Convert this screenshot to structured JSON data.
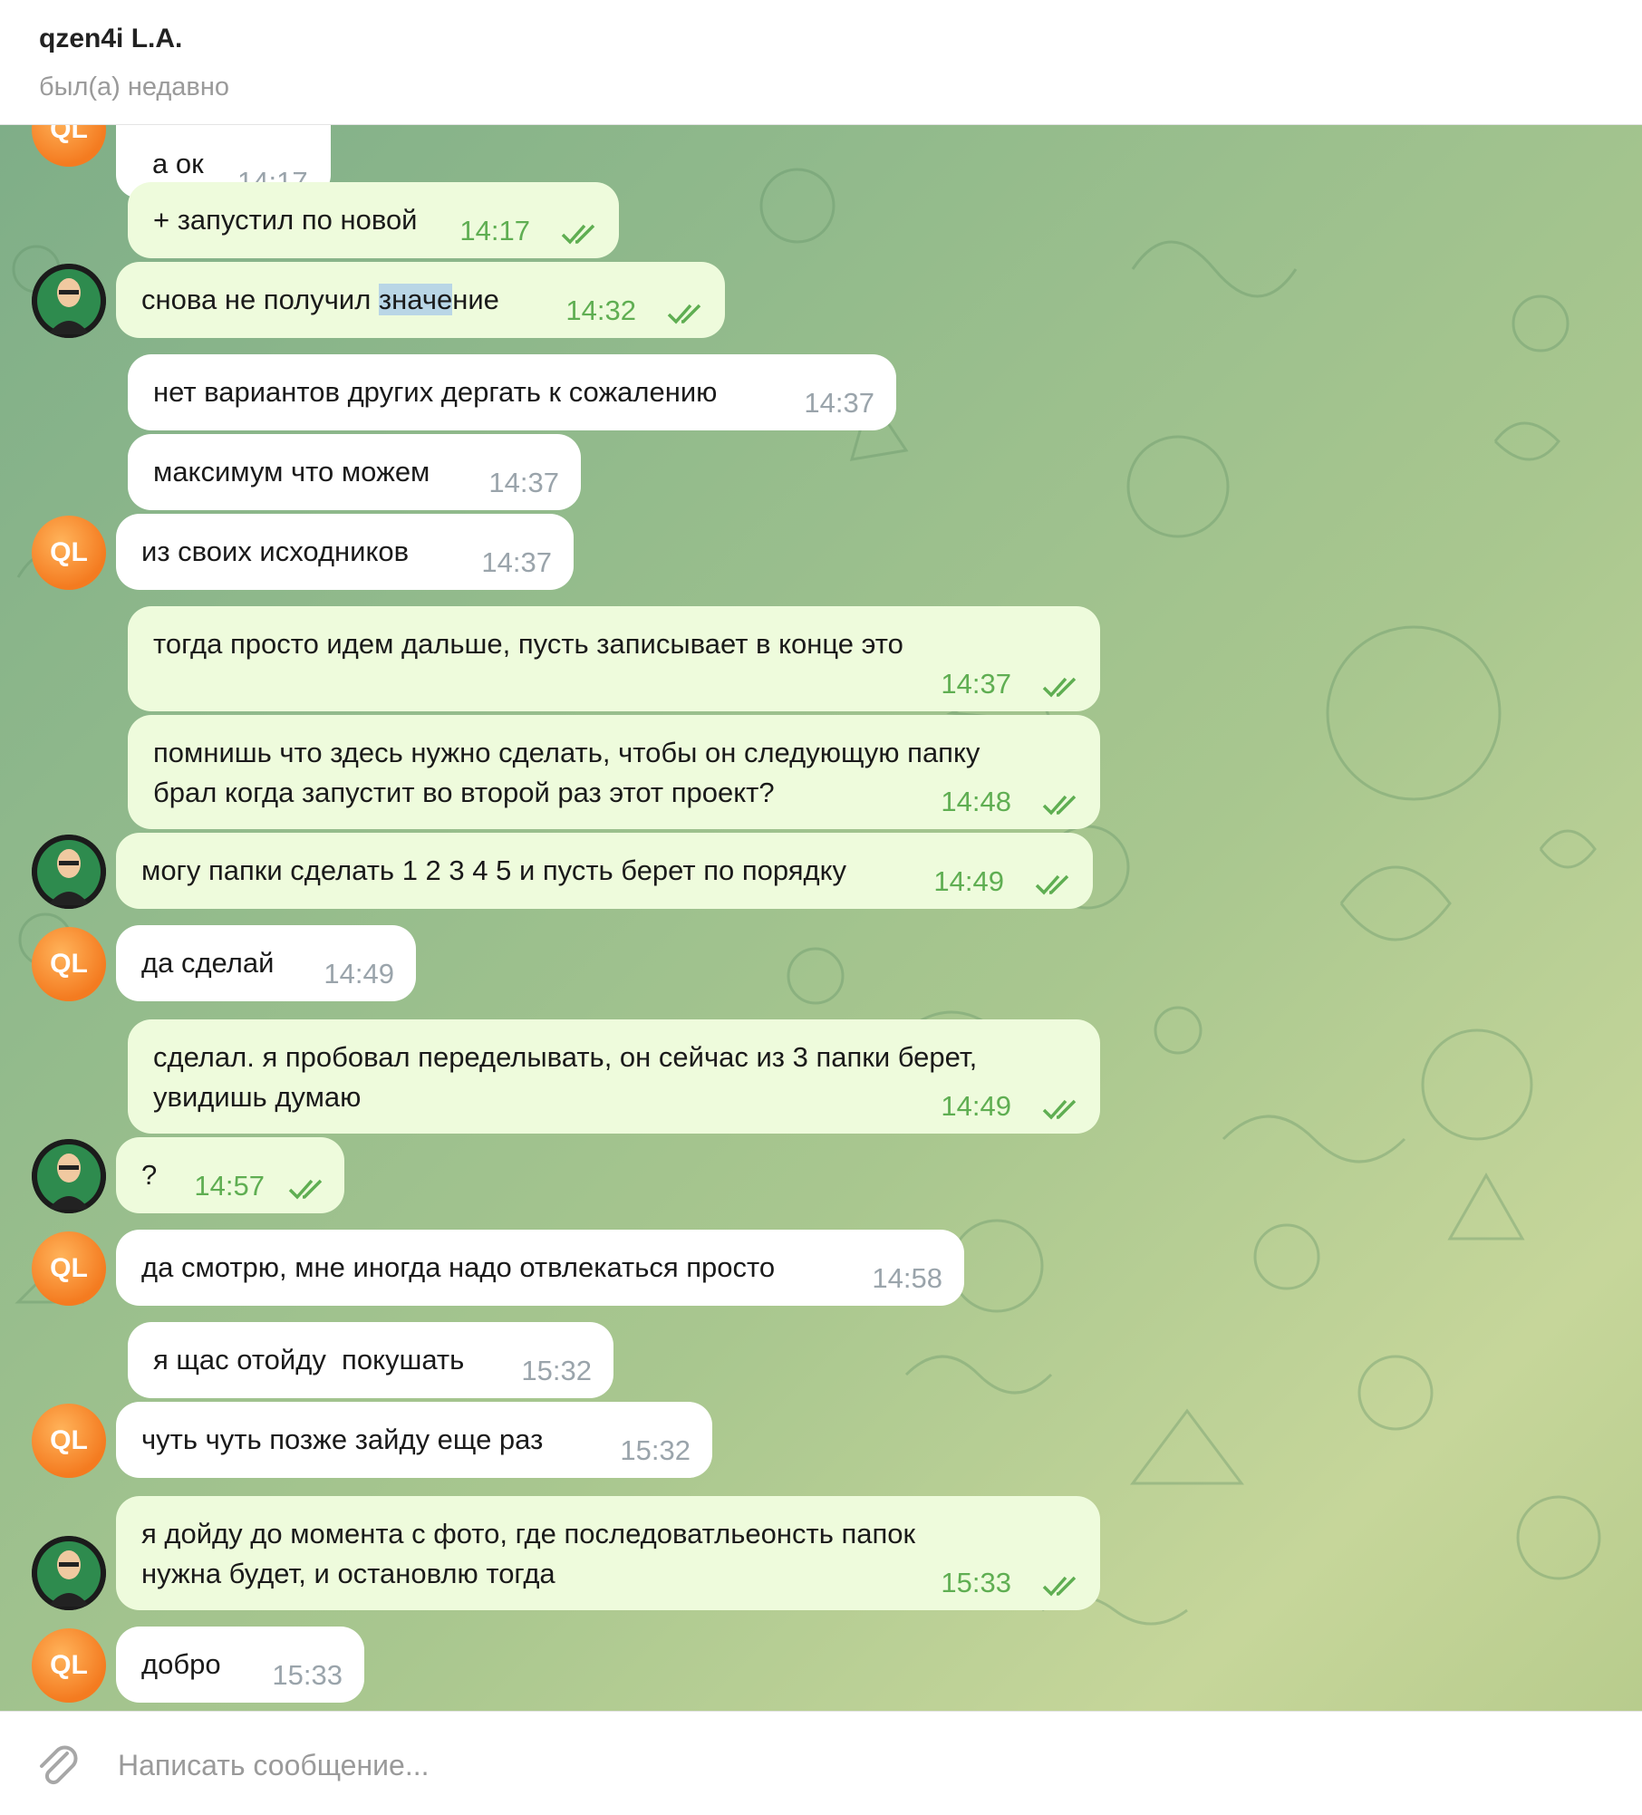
{
  "header": {
    "title": "qzen4i L.A.",
    "status": "был(а) недавно"
  },
  "avatars": {
    "ql_initials": "QL"
  },
  "messages": [
    {
      "dir": "in",
      "text": "а ок",
      "time": "14:17"
    },
    {
      "dir": "out",
      "text": "+ запустил по новой",
      "time": "14:17",
      "read": true
    },
    {
      "dir": "out",
      "text_before": "снова не получил ",
      "text_selected": "значе",
      "text_after": "ние",
      "time": "14:32",
      "read": true
    },
    {
      "dir": "in",
      "text": "нет вариантов других дергать к сожалению",
      "time": "14:37"
    },
    {
      "dir": "in",
      "text": "максимум что можем",
      "time": "14:37"
    },
    {
      "dir": "in",
      "text": "из своих исходников",
      "time": "14:37"
    },
    {
      "dir": "out",
      "text": "тогда просто идем дальше, пусть записывает в конце это",
      "time": "14:37",
      "read": true
    },
    {
      "dir": "out",
      "text": "помнишь что здесь нужно сделать, чтобы он следующую папку\nбрал когда запустит во второй раз этот проект?",
      "time": "14:48",
      "read": true
    },
    {
      "dir": "out",
      "text": "могу папки сделать 1 2 3 4 5 и пусть берет по порядку",
      "time": "14:49",
      "read": true
    },
    {
      "dir": "in",
      "text": "да сделай",
      "time": "14:49"
    },
    {
      "dir": "out",
      "text": "сделал. я пробовал переделывать, он сейчас из 3 папки берет,\nувидишь думаю",
      "time": "14:49",
      "read": true
    },
    {
      "dir": "out",
      "text": "?",
      "time": "14:57",
      "read": true
    },
    {
      "dir": "in",
      "text": "да смотрю, мне иногда надо отвлекаться просто",
      "time": "14:58"
    },
    {
      "dir": "in",
      "text": "я щас отойду  покушать",
      "time": "15:32"
    },
    {
      "dir": "in",
      "text": "чуть чуть позже зайду еще раз",
      "time": "15:32"
    },
    {
      "dir": "out",
      "text": "я дойду до момента с фото, где последоватльеонсть папок\nнужна будет, и остановлю тогда",
      "time": "15:33",
      "read": true
    },
    {
      "dir": "in",
      "text": "добро",
      "time": "15:33"
    }
  ],
  "composer": {
    "placeholder": "Написать сообщение..."
  },
  "colors": {
    "incoming_bubble": "#ffffff",
    "outgoing_bubble": "#eefbdc",
    "read_ticks": "#5fae52",
    "avatar_orange": "#f47b20"
  },
  "icons": {
    "attach": "paperclip-icon",
    "read": "double-check-icon"
  }
}
